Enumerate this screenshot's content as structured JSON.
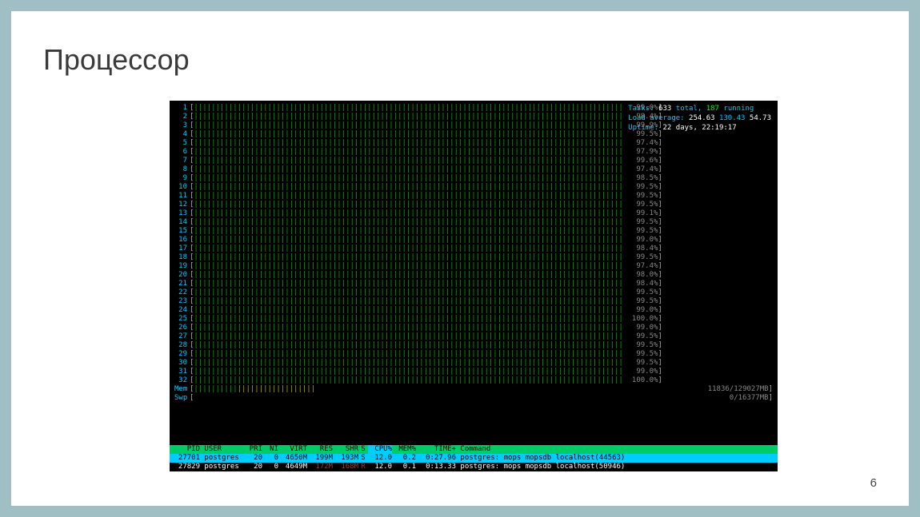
{
  "slide": {
    "title": "Процессор",
    "page_number": "6"
  },
  "htop": {
    "cpus": [
      {
        "n": 1,
        "pct": "99.0%",
        "red": 4
      },
      {
        "n": 2,
        "pct": "98.4%",
        "red": 0
      },
      {
        "n": 3,
        "pct": "99.9%",
        "red": 3
      },
      {
        "n": 4,
        "pct": "99.5%",
        "red": 3
      },
      {
        "n": 5,
        "pct": "97.4%",
        "red": 0
      },
      {
        "n": 6,
        "pct": "97.9%",
        "red": 0
      },
      {
        "n": 7,
        "pct": "99.6%",
        "red": 0
      },
      {
        "n": 8,
        "pct": "97.4%",
        "red": 0
      },
      {
        "n": 9,
        "pct": "98.5%",
        "red": 0
      },
      {
        "n": 10,
        "pct": "99.5%",
        "red": 3
      },
      {
        "n": 11,
        "pct": "99.5%",
        "red": 3
      },
      {
        "n": 12,
        "pct": "99.5%",
        "red": 0
      },
      {
        "n": 13,
        "pct": "99.1%",
        "red": 3
      },
      {
        "n": 14,
        "pct": "99.5%",
        "red": 0
      },
      {
        "n": 15,
        "pct": "99.5%",
        "red": 0
      },
      {
        "n": 16,
        "pct": "99.0%",
        "red": 3
      },
      {
        "n": 17,
        "pct": "98.4%",
        "red": 0
      },
      {
        "n": 18,
        "pct": "99.5%",
        "red": 0
      },
      {
        "n": 19,
        "pct": "97.4%",
        "red": 3
      },
      {
        "n": 20,
        "pct": "98.0%",
        "red": 3
      },
      {
        "n": 21,
        "pct": "98.4%",
        "red": 0
      },
      {
        "n": 22,
        "pct": "99.5%",
        "red": 0
      },
      {
        "n": 23,
        "pct": "99.5%",
        "red": 0
      },
      {
        "n": 24,
        "pct": "99.0%",
        "red": 0
      },
      {
        "n": 25,
        "pct": "100.0%",
        "red": 5
      },
      {
        "n": 26,
        "pct": "99.0%",
        "red": 0
      },
      {
        "n": 27,
        "pct": "99.5%",
        "red": 3
      },
      {
        "n": 28,
        "pct": "99.5%",
        "red": 3
      },
      {
        "n": 29,
        "pct": "99.5%",
        "red": 0
      },
      {
        "n": 30,
        "pct": "99.5%",
        "red": 0
      },
      {
        "n": 31,
        "pct": "99.0%",
        "red": 0
      },
      {
        "n": 32,
        "pct": "100.0%",
        "red": 0
      }
    ],
    "mem": {
      "label": "Mem",
      "used": "11836",
      "total": "129027MB"
    },
    "swp": {
      "label": "Swp",
      "used": "0",
      "total": "16377MB"
    },
    "tasks": {
      "label": "Tasks:",
      "total": "633",
      "total_sfx": "total,",
      "running": "187",
      "running_sfx": "running"
    },
    "load": {
      "label": "Load average:",
      "v1": "254.63",
      "v2": "130.43",
      "v3": "54.73"
    },
    "uptime": {
      "label": "Uptime:",
      "value": "22 days, 22:19:17"
    },
    "columns": {
      "pid": "PID",
      "user": "USER",
      "pri": "PRI",
      "ni": "NI",
      "virt": "VIRT",
      "res": "RES",
      "shr": "SHR",
      "s": "S",
      "cpu": "CPU%",
      "mem": "MEM%",
      "time": "TIME+",
      "cmd": "Command"
    },
    "processes": [
      {
        "pid": "27701",
        "user": "postgres",
        "pri": "20",
        "ni": "0",
        "virt": "4650M",
        "res": "199M",
        "shr": "193M",
        "s": "S",
        "cpu": "12.0",
        "mem": "0.2",
        "time": "0:27.96",
        "cmd": "postgres: mops mopsdb localhost(44563)",
        "sel": true
      },
      {
        "pid": "27829",
        "user": "postgres",
        "pri": "20",
        "ni": "0",
        "virt": "4649M",
        "res": "172M",
        "shr": "168M",
        "s": "R",
        "cpu": "12.0",
        "mem": "0.1",
        "time": "0:13.33",
        "cmd": "postgres: mops mopsdb localhost(50946)",
        "sel": false
      }
    ]
  }
}
